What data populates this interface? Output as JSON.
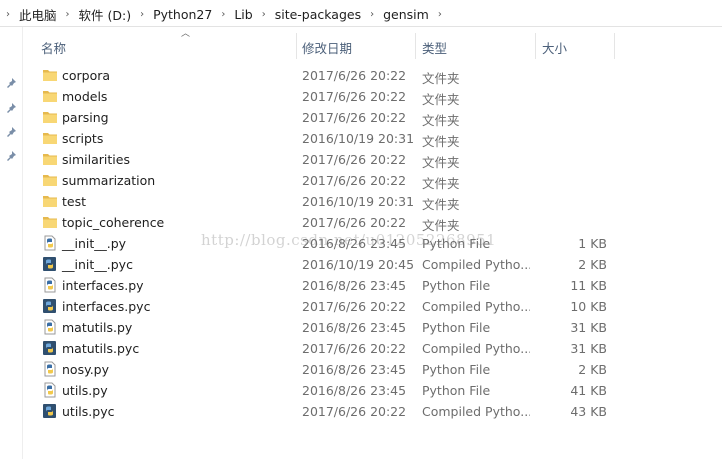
{
  "breadcrumb": {
    "items": [
      "此电脑",
      "软件 (D:)",
      "Python27",
      "Lib",
      "site-packages",
      "gensim"
    ]
  },
  "columns": {
    "name": "名称",
    "date": "修改日期",
    "type": "类型",
    "size": "大小",
    "sorted_by": "name"
  },
  "files": [
    {
      "name": "corpora",
      "date": "2017/6/26 20:22",
      "type": "文件夹",
      "size": "",
      "icon": "folder-icon"
    },
    {
      "name": "models",
      "date": "2017/6/26 20:22",
      "type": "文件夹",
      "size": "",
      "icon": "folder-icon"
    },
    {
      "name": "parsing",
      "date": "2017/6/26 20:22",
      "type": "文件夹",
      "size": "",
      "icon": "folder-icon"
    },
    {
      "name": "scripts",
      "date": "2016/10/19 20:31",
      "type": "文件夹",
      "size": "",
      "icon": "folder-icon"
    },
    {
      "name": "similarities",
      "date": "2017/6/26 20:22",
      "type": "文件夹",
      "size": "",
      "icon": "folder-icon"
    },
    {
      "name": "summarization",
      "date": "2017/6/26 20:22",
      "type": "文件夹",
      "size": "",
      "icon": "folder-icon"
    },
    {
      "name": "test",
      "date": "2016/10/19 20:31",
      "type": "文件夹",
      "size": "",
      "icon": "folder-icon"
    },
    {
      "name": "topic_coherence",
      "date": "2017/6/26 20:22",
      "type": "文件夹",
      "size": "",
      "icon": "folder-icon"
    },
    {
      "name": "__init__.py",
      "date": "2016/8/26 23:45",
      "type": "Python File",
      "size": "1 KB",
      "icon": "python-file-icon"
    },
    {
      "name": "__init__.pyc",
      "date": "2016/10/19 20:45",
      "type": "Compiled Pytho...",
      "size": "2 KB",
      "icon": "compiled-python-icon"
    },
    {
      "name": "interfaces.py",
      "date": "2016/8/26 23:45",
      "type": "Python File",
      "size": "11 KB",
      "icon": "python-file-icon"
    },
    {
      "name": "interfaces.pyc",
      "date": "2017/6/26 20:22",
      "type": "Compiled Pytho...",
      "size": "10 KB",
      "icon": "compiled-python-icon"
    },
    {
      "name": "matutils.py",
      "date": "2016/8/26 23:45",
      "type": "Python File",
      "size": "31 KB",
      "icon": "python-file-icon"
    },
    {
      "name": "matutils.pyc",
      "date": "2017/6/26 20:22",
      "type": "Compiled Pytho...",
      "size": "31 KB",
      "icon": "compiled-python-icon"
    },
    {
      "name": "nosy.py",
      "date": "2016/8/26 23:45",
      "type": "Python File",
      "size": "2 KB",
      "icon": "python-file-icon"
    },
    {
      "name": "utils.py",
      "date": "2016/8/26 23:45",
      "type": "Python File",
      "size": "41 KB",
      "icon": "python-file-icon"
    },
    {
      "name": "utils.pyc",
      "date": "2017/6/26 20:22",
      "type": "Compiled Pytho...",
      "size": "43 KB",
      "icon": "compiled-python-icon"
    }
  ],
  "watermark": "http://blog.csdn.net/u012052268951",
  "colors": {
    "folder": "#f8d775",
    "header_text": "#4c607a",
    "detail_text": "#6d6d6d"
  }
}
